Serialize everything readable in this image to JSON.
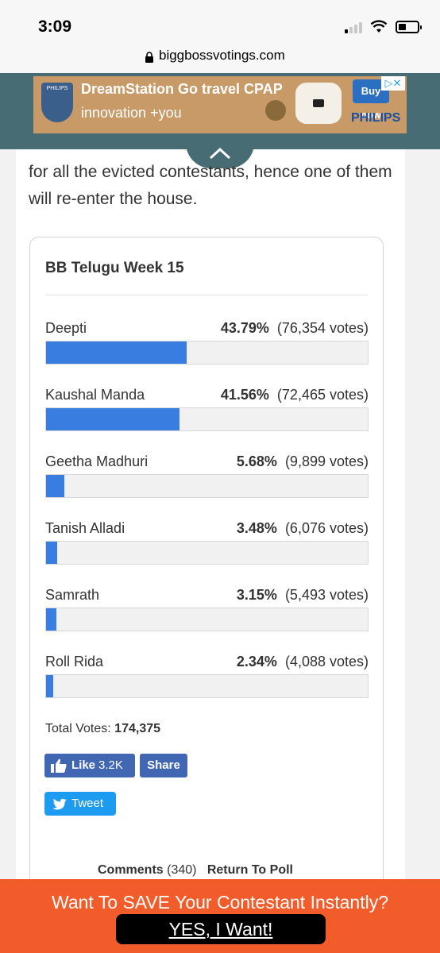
{
  "status": {
    "time": "3:09"
  },
  "browser": {
    "url": "biggbossvotings.com"
  },
  "ad": {
    "headline": "DreamStation Go travel CPAP",
    "sub": "innovation +you",
    "logo_text": "PHILIPS",
    "buy": "Buy now",
    "brand": "PHILIPS",
    "choice": "▷✕"
  },
  "article": {
    "intro": "for all the evicted contestants, hence one of them will re-enter the house."
  },
  "poll": {
    "title": "BB Telugu Week 15",
    "options": [
      {
        "name": "Deepti",
        "percent": "43.79%",
        "votes": "(76,354 votes)",
        "value": 43.79
      },
      {
        "name": "Kaushal Manda",
        "percent": "41.56%",
        "votes": "(72,465 votes)",
        "value": 41.56
      },
      {
        "name": "Geetha Madhuri",
        "percent": "5.68%",
        "votes": "(9,899 votes)",
        "value": 5.68
      },
      {
        "name": "Tanish Alladi",
        "percent": "3.48%",
        "votes": "(6,076 votes)",
        "value": 3.48
      },
      {
        "name": "Samrath",
        "percent": "3.15%",
        "votes": "(5,493 votes)",
        "value": 3.15
      },
      {
        "name": "Roll Rida",
        "percent": "2.34%",
        "votes": "(4,088 votes)",
        "value": 2.34
      }
    ],
    "total_label": "Total Votes:",
    "total_value": "174,375",
    "like_label": "Like",
    "like_count": "3.2K",
    "share_label": "Share",
    "tweet_label": "Tweet",
    "comments_label": "Comments",
    "comments_count": "(340)",
    "return_label": "Return To Poll"
  },
  "sticky": {
    "text": "Want To SAVE Your Contestant Instantly?",
    "button": "YES, I Want!"
  },
  "colors": {
    "bar": "#3a7de0",
    "sticky": "#f25c2a",
    "facebook": "#4267b2",
    "twitter": "#1d9bf0"
  }
}
